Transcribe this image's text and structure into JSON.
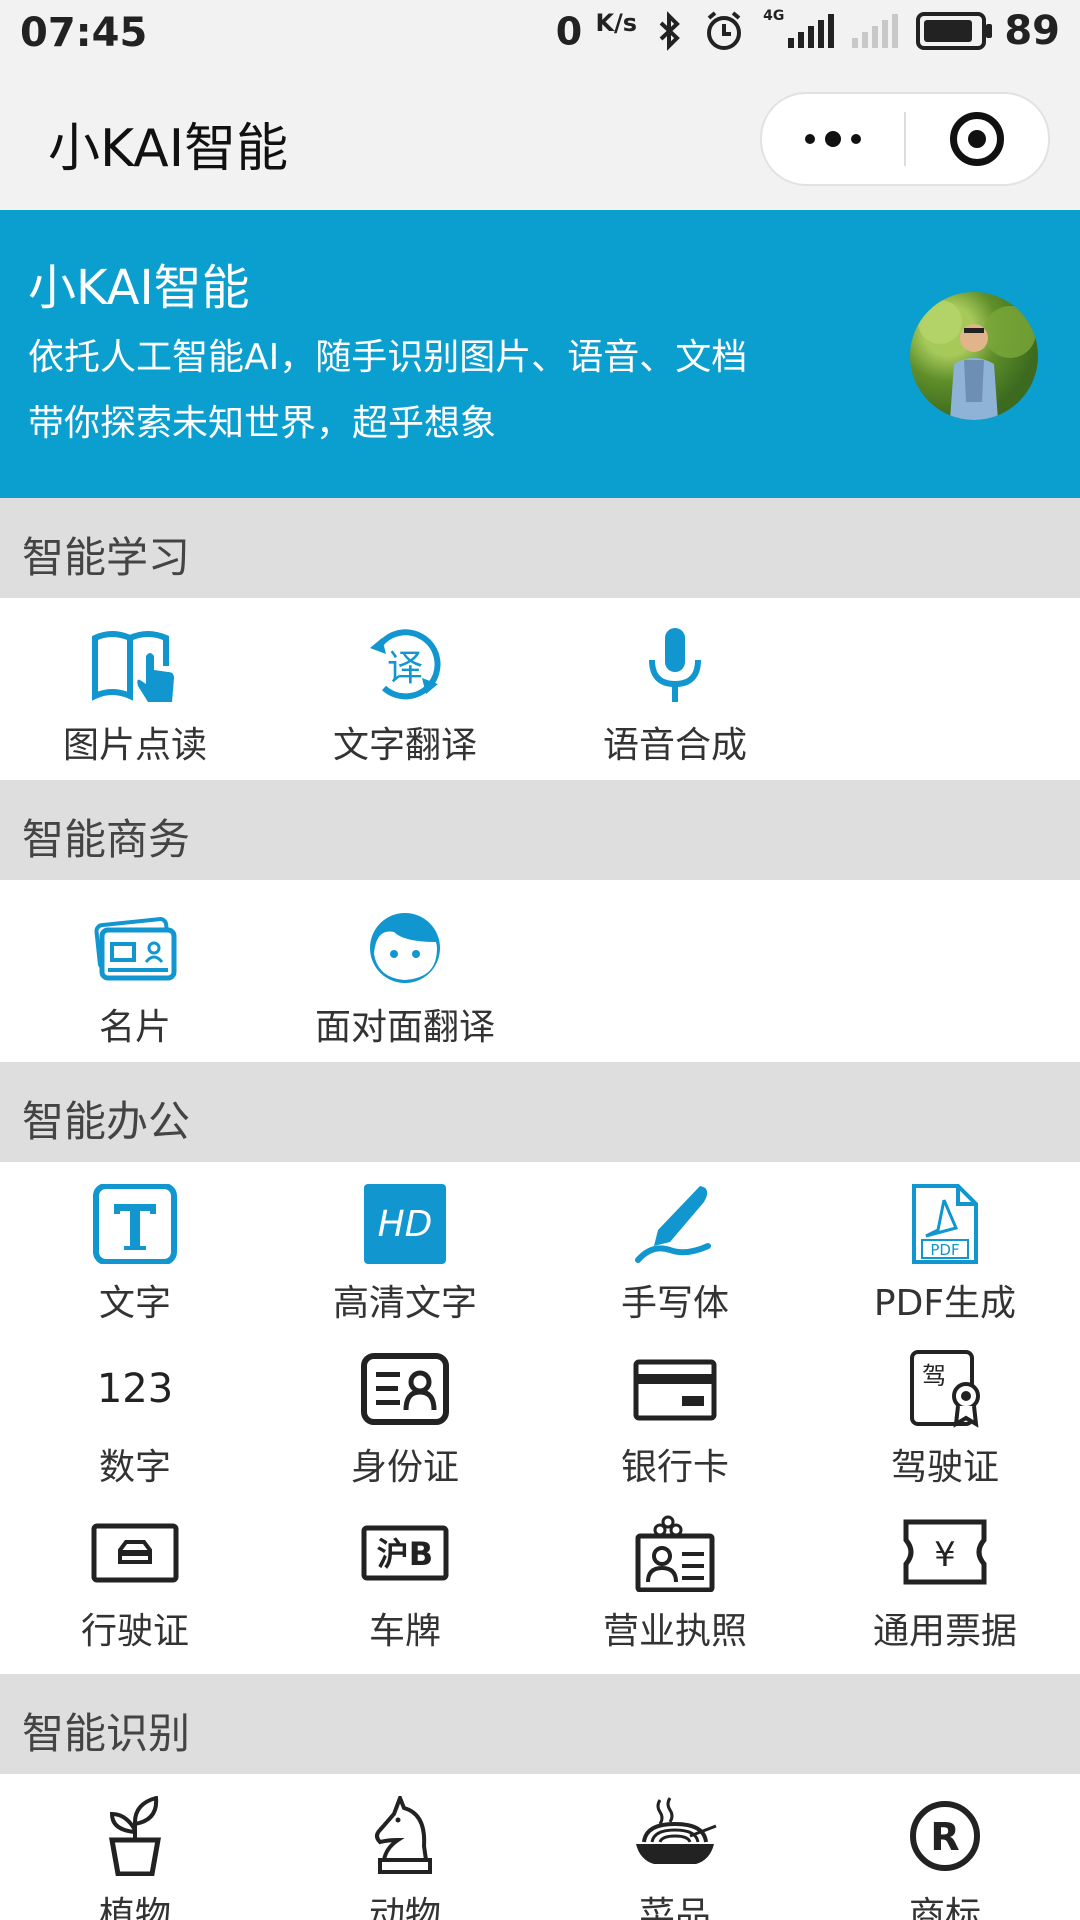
{
  "status_bar": {
    "time": "07:45",
    "net_speed": "0",
    "net_unit": "K/s",
    "network": "4G",
    "battery": "89"
  },
  "nav": {
    "title": "小KAI智能"
  },
  "banner": {
    "title": "小KAI智能",
    "line1": "依托人工智能AI，随手识别图片、语音、文档",
    "line2": "带你探索未知世界，超乎想象"
  },
  "sections": [
    {
      "title": "智能学习",
      "items": [
        {
          "label": "图片点读",
          "icon": "book-touch-icon"
        },
        {
          "label": "文字翻译",
          "icon": "translate-icon"
        },
        {
          "label": "语音合成",
          "icon": "microphone-icon"
        }
      ]
    },
    {
      "title": "智能商务",
      "items": [
        {
          "label": "名片",
          "icon": "business-card-icon"
        },
        {
          "label": "面对面翻译",
          "icon": "face-icon"
        }
      ]
    },
    {
      "title": "智能办公",
      "items": [
        {
          "label": "文字",
          "icon": "text-t-icon"
        },
        {
          "label": "高清文字",
          "icon": "hd-icon",
          "icon_text": "HD"
        },
        {
          "label": "手写体",
          "icon": "pen-icon"
        },
        {
          "label": "PDF生成",
          "icon": "pdf-icon",
          "icon_text": "PDF"
        },
        {
          "label": "数字",
          "icon": "numbers-icon",
          "icon_text": "123"
        },
        {
          "label": "身份证",
          "icon": "id-card-icon"
        },
        {
          "label": "银行卡",
          "icon": "bank-card-icon"
        },
        {
          "label": "驾驶证",
          "icon": "driver-license-icon",
          "icon_text": "驾"
        },
        {
          "label": "行驶证",
          "icon": "vehicle-license-icon"
        },
        {
          "label": "车牌",
          "icon": "license-plate-icon",
          "icon_text": "沪B"
        },
        {
          "label": "营业执照",
          "icon": "business-license-icon"
        },
        {
          "label": "通用票据",
          "icon": "receipt-icon",
          "icon_text": "¥"
        }
      ]
    },
    {
      "title": "智能识别",
      "items": [
        {
          "label": "植物",
          "icon": "plant-icon"
        },
        {
          "label": "动物",
          "icon": "horse-icon"
        },
        {
          "label": "菜品",
          "icon": "dish-icon"
        },
        {
          "label": "商标",
          "icon": "trademark-icon",
          "icon_text": "R"
        }
      ]
    }
  ],
  "colors": {
    "accent": "#0b9fd0",
    "icon_blue": "#1196d0",
    "section_bg": "#dedede"
  }
}
